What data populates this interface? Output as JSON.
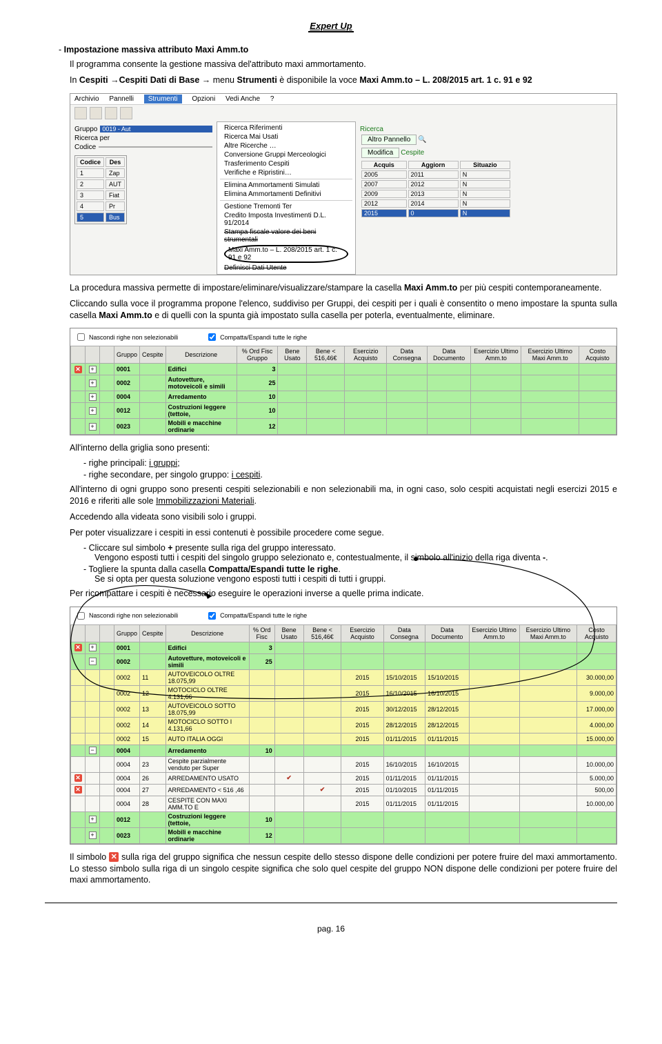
{
  "header_title": "Expert Up",
  "sec_title": "Impostazione massiva attributo Maxi Amm.to",
  "p1": "Il programma consente la gestione massiva del'attributo maxi ammortamento.",
  "p2_a": "In ",
  "p2_b": "Cespiti",
  "p2_c": "Cespiti Dati di Base",
  "p2_d": " menu ",
  "p2_e": "Strumenti",
  "p2_f": " è disponibile la voce ",
  "p2_g": "Maxi Amm.to – L. 208/2015 art. 1 c. 91 e 92",
  "ss1": {
    "menubar": [
      "Archivio",
      "Pannelli",
      "Strumenti",
      "Opzioni",
      "Vedi Anche",
      "?"
    ],
    "gruppo_lbl": "Gruppo",
    "gruppo_val": "0019 - Aut",
    "ricerca_lbl": "Ricerca per",
    "codice_lbl": "Codice",
    "tbl_h1": "Codice",
    "tbl_h2": "Des",
    "rows": [
      [
        "1",
        "Zap"
      ],
      [
        "2",
        "AUT"
      ],
      [
        "3",
        "Fiat"
      ],
      [
        "4",
        "Pr"
      ],
      [
        "5",
        "Bus"
      ]
    ],
    "menu": [
      "Ricerca Riferimenti",
      "Ricerca Mai Usati",
      "Altre Ricerche …",
      "Conversione Gruppi Merceologici",
      "Trasferimento Cespiti",
      "Verifiche e Ripristini…",
      "Elimina Ammortamenti Simulati",
      "Elimina Ammortamenti Definitivi",
      "Gestione Tremonti Ter",
      "Credito Imposta Investimenti D.L. 91/2014",
      "Stampa fiscale valore dei beni strumentali",
      "Maxi Amm.to – L. 208/2015 art. 1 c. 91 e 92",
      "Definisci Dati Utente"
    ],
    "ricerca_link": "Ricerca",
    "altro_btn": "Altro Pannello",
    "modifica_btn": "Modifica",
    "cespite_lbl": "Cespite",
    "mini_h": [
      "Acquis",
      "Aggiorn",
      "Situazio"
    ],
    "mini_rows": [
      [
        "2005",
        "2011",
        "N"
      ],
      [
        "2007",
        "2012",
        "N"
      ],
      [
        "2009",
        "2013",
        "N"
      ],
      [
        "2012",
        "2014",
        "N"
      ],
      [
        "2015",
        "0",
        "N"
      ]
    ]
  },
  "p3_a": "La procedura massiva permette di impostare/eliminare/visualizzare/stampare la casella ",
  "p3_b": "Maxi Amm.to",
  "p3_c": " per più cespiti contemporaneamente.",
  "p4_a": "Cliccando sulla voce il programma propone l'elenco, suddiviso per Gruppi, dei cespiti per i quali è consentito o meno impostare la spunta sulla casella ",
  "p4_b": "Maxi Amm.to",
  "p4_c": " e di quelli con la spunta già impostato sulla casella per poterla, eventualmente, eliminare.",
  "grid1": {
    "chk1": "Nascondi righe non selezionabili",
    "chk2": "Compatta/Espandi tutte le righe",
    "heads": [
      "",
      "",
      "",
      "Gruppo",
      "Cespite",
      "Descrizione",
      "% Ord Fisc Gruppo",
      "Bene Usato",
      "Bene < 516,46€",
      "Esercizio Acquisto",
      "Data Consegna",
      "Data Documento",
      "Esercizio Ultimo Amm.to",
      "Esercizio Ultimo Maxi Amm.to",
      "Costo Acquisto"
    ],
    "rows": [
      [
        "0001",
        "",
        "Edifici",
        "3"
      ],
      [
        "0002",
        "",
        "Autovetture, motoveicoli e simili",
        "25"
      ],
      [
        "0004",
        "",
        "Arredamento",
        "10"
      ],
      [
        "0012",
        "",
        "Costruzioni leggere (tettoie,",
        "10"
      ],
      [
        "0023",
        "",
        "Mobili e macchine ordinarie",
        "12"
      ]
    ]
  },
  "p5": "All'interno della griglia sono presenti:",
  "li5a": "righe principali: ",
  "li5a_u": "i gruppi",
  "li5b": "righe secondare, per singolo gruppo: ",
  "li5b_u": "i cespiti",
  "p6_a": "All'interno di ogni gruppo sono presenti cespiti selezionabili e non selezionabili ma, in ogni caso, solo cespiti acquistati negli esercizi 2015 e 2016 e riferiti alle sole ",
  "p6_b": "Immobilizzazioni Materiali",
  "p6_c": ".",
  "p7": "Accedendo alla videata sono visibili solo i gruppi.",
  "p8": "Per poter visualizzare i cespiti in essi contenuti è possibile procedere come segue.",
  "li8a_a": "Cliccare sul simbolo ",
  "li8a_b": "+",
  "li8a_c": " presente sulla riga del gruppo interessato.",
  "li8a_d": "Vengono esposti tutti i cespiti del singolo gruppo selezionato e, contestualmente, il simbolo all'inizio della riga diventa ",
  "li8a_e": "-",
  "li8a_f": ".",
  "li8b_a": "Togliere la spunta dalla casella ",
  "li8b_b": "Compatta/Espandi tutte le righe",
  "li8b_c": ".",
  "li8b_d": "Se si opta per questa soluzione vengono esposti tutti i cespiti di tutti i gruppi.",
  "p9": "Per ricompattare i cespiti è necessario eseguire le operazioni inverse a quelle prima indicate.",
  "grid2": {
    "chk1": "Nascondi righe non selezionabili",
    "chk2": "Compatta/Espandi tutte le righe",
    "heads": [
      "",
      "",
      "",
      "Gruppo",
      "Cespite",
      "Descrizione",
      "% Ord Fisc",
      "Bene Usato",
      "Bene < 516,46€",
      "Esercizio Acquisto",
      "Data Consegna",
      "Data Documento",
      "Esercizio Ultimo Amm.to",
      "Esercizio Ultimo Maxi Amm.to",
      "Costo Acquisto"
    ],
    "rows": [
      {
        "c": "grn",
        "x": "x",
        "pm": "+",
        "g": "0001",
        "cs": "",
        "d": "Edifici",
        "p": "3"
      },
      {
        "c": "grn",
        "x": "",
        "pm": "-",
        "g": "0002",
        "cs": "",
        "d": "Autovetture, motoveicoli e simili",
        "p": "25"
      },
      {
        "c": "lyl",
        "x": "",
        "pm": "",
        "g": "0002",
        "cs": "11",
        "d": "AUTOVEICOLO OLTRE 18.075,99",
        "ea": "2015",
        "dc": "15/10/2015",
        "dd": "15/10/2015",
        "ca": "30.000,00"
      },
      {
        "c": "lyl",
        "x": "",
        "pm": "",
        "g": "0002",
        "cs": "12",
        "d": "MOTOCICLO OLTRE 4.131,66",
        "ea": "2015",
        "dc": "16/10/2015",
        "dd": "16/10/2015",
        "ca": "9.000,00"
      },
      {
        "c": "lyl",
        "x": "",
        "pm": "",
        "g": "0002",
        "cs": "13",
        "d": "AUTOVEICOLO SOTTO 18.075,99",
        "ea": "2015",
        "dc": "30/12/2015",
        "dd": "28/12/2015",
        "ca": "17.000,00"
      },
      {
        "c": "lyl",
        "x": "",
        "pm": "",
        "g": "0002",
        "cs": "14",
        "d": "MOTOCICLO SOTTO I 4.131,66",
        "ea": "2015",
        "dc": "28/12/2015",
        "dd": "28/12/2015",
        "ca": "4.000,00"
      },
      {
        "c": "lyl",
        "x": "",
        "pm": "",
        "g": "0002",
        "cs": "15",
        "d": "AUTO ITALIA OGGI",
        "ea": "2015",
        "dc": "01/11/2015",
        "dd": "01/11/2015",
        "ca": "15.000,00"
      },
      {
        "c": "grn",
        "x": "",
        "pm": "-",
        "g": "0004",
        "cs": "",
        "d": "Arredamento",
        "p": "10"
      },
      {
        "c": "wht",
        "x": "",
        "pm": "",
        "g": "0004",
        "cs": "23",
        "d": "Cespite parzialmente venduto per Super",
        "ea": "2015",
        "dc": "16/10/2015",
        "dd": "16/10/2015",
        "ca": "10.000,00"
      },
      {
        "c": "wht",
        "x": "x",
        "pm": "",
        "g": "0004",
        "cs": "26",
        "d": "ARREDAMENTO USATO",
        "bu": "✔",
        "ea": "2015",
        "dc": "01/11/2015",
        "dd": "01/11/2015",
        "ca": "5.000,00"
      },
      {
        "c": "wht",
        "x": "x",
        "pm": "",
        "g": "0004",
        "cs": "27",
        "d": "ARREDAMENTO < 516 ,46",
        "b5": "✔",
        "ea": "2015",
        "dc": "01/10/2015",
        "dd": "01/11/2015",
        "ca": "500,00"
      },
      {
        "c": "wht",
        "x": "",
        "pm": "",
        "g": "0004",
        "cs": "28",
        "d": "CESPITE CON MAXI AMM.TO E",
        "ea": "2015",
        "dc": "01/11/2015",
        "dd": "01/11/2015",
        "ca": "10.000,00"
      },
      {
        "c": "grn",
        "x": "",
        "pm": "+",
        "g": "0012",
        "cs": "",
        "d": "Costruzioni leggere (tettoie,",
        "p": "10"
      },
      {
        "c": "grn",
        "x": "",
        "pm": "+",
        "g": "0023",
        "cs": "",
        "d": "Mobili e macchine ordinarie",
        "p": "12"
      }
    ]
  },
  "p10_a": "Il simbolo ",
  "p10_b": " sulla riga del gruppo significa che nessun cespite dello stesso dispone delle condizioni per potere fruire del maxi ammortamento. Lo stesso simbolo sulla riga di un singolo cespite significa che solo quel cespite del gruppo NON dispone delle condizioni per potere fruire del maxi ammortamento.",
  "page_num": "pag. 16"
}
